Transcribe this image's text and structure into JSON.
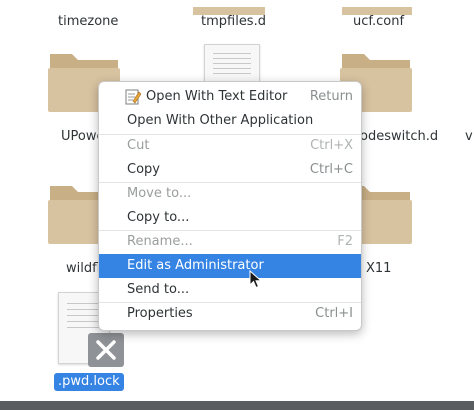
{
  "files": {
    "timezone": "timezone",
    "tmpfiles": "tmpfiles.d",
    "ucf": "ucf.conf",
    "upower": "UPowe",
    "modeswitch": "odeswitch.d",
    "edge_v": "v",
    "wildfly": "wildfl",
    "x11": "X11",
    "pwd_lock": ".pwd.lock"
  },
  "context_menu": {
    "open_text_editor": {
      "label": "Open With Text Editor",
      "accel": "Return",
      "icon": "text-editor-icon"
    },
    "open_other_app": {
      "label": "Open With Other Application"
    },
    "cut": {
      "label": "Cut",
      "accel": "Ctrl+X"
    },
    "copy": {
      "label": "Copy",
      "accel": "Ctrl+C"
    },
    "move_to": {
      "label": "Move to..."
    },
    "copy_to": {
      "label": "Copy to..."
    },
    "rename": {
      "label": "Rename...",
      "accel": "F2"
    },
    "edit_admin": {
      "label": "Edit as Administrator"
    },
    "send_to": {
      "label": "Send to..."
    },
    "properties": {
      "label": "Properties",
      "accel": "Ctrl+I"
    }
  },
  "colors": {
    "selection": "#3584e4",
    "folder": "#d8c3a0",
    "folder_tab": "#c8af86"
  }
}
